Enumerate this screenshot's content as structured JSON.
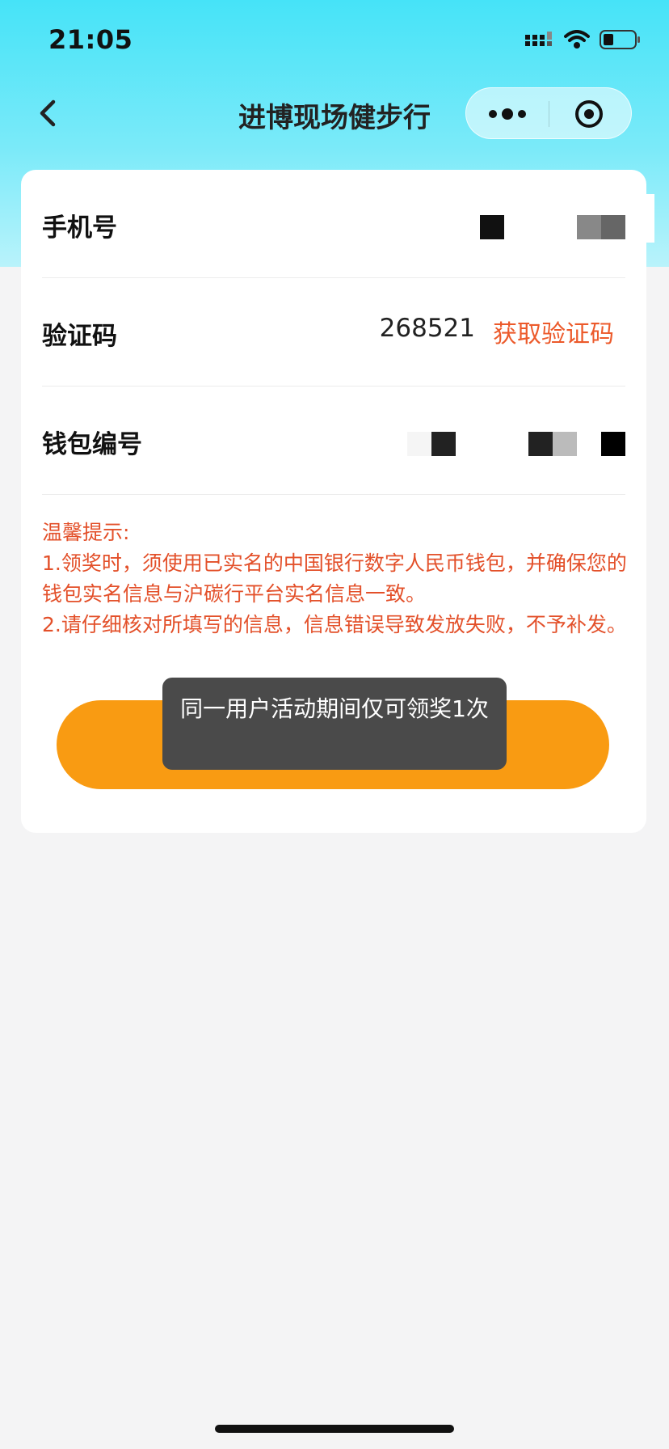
{
  "status_bar": {
    "time": "21:05"
  },
  "nav": {
    "title": "进博现场健步行"
  },
  "form": {
    "phone_label": "手机号",
    "code_label": "验证码",
    "code_value": "268521",
    "get_code_label": "获取验证码",
    "wallet_label": "钱包编号"
  },
  "tips": {
    "title": "温馨提示:",
    "line1": "1.领奖时，须使用已实名的中国银行数字人民币钱包，并确保您的钱包实名信息与沪碳行平台实名信息一致。",
    "line2": "2.请仔细核对所填写的信息，信息错误导致发放失败，不予补发。"
  },
  "toast": {
    "text": "同一用户活动期间仅可领奖1次"
  },
  "colors": {
    "accent_orange": "#f99b12",
    "tip_red": "#e3502a",
    "link_red": "#ec5a2b"
  },
  "icons": {
    "back": "chevron-left-icon",
    "more": "more-dots-icon",
    "home": "target-icon",
    "signal": "signal-icon",
    "wifi": "wifi-icon",
    "battery": "battery-icon"
  }
}
